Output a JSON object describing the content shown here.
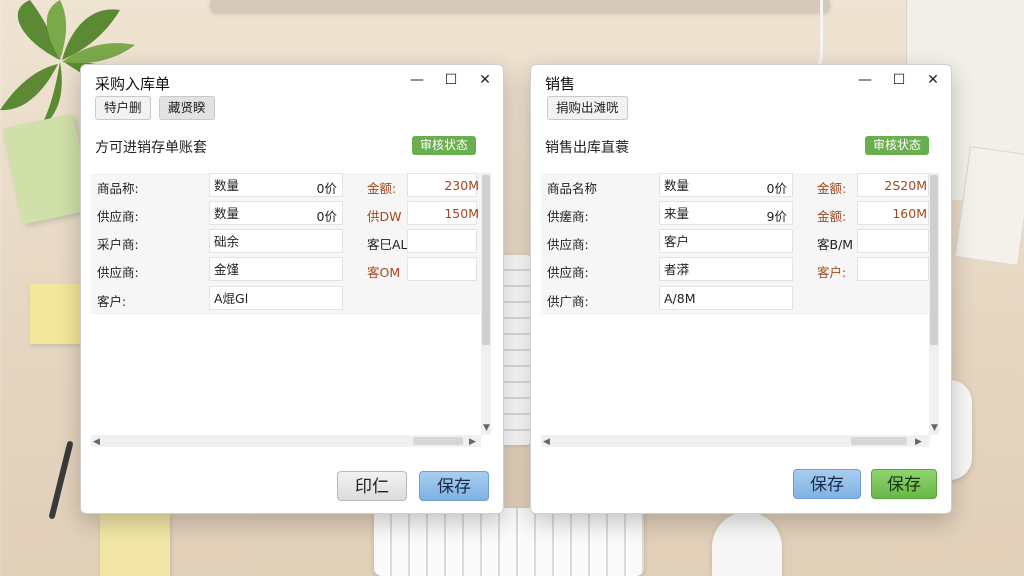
{
  "left_window": {
    "title": "采购入库单",
    "toolbar": [
      "特户删",
      "藏贤睽"
    ],
    "subtitle": "方可进销存单账套",
    "badge": "审核状态",
    "rows": [
      {
        "label": "商品称:",
        "mid": "数量",
        "mid_value": "0价",
        "right_label": "金额:",
        "right_value": "230M"
      },
      {
        "label": "供应商:",
        "mid": "数量",
        "mid_value": "0价",
        "right_label": "供DW",
        "right_value": "150M"
      },
      {
        "label": "采户商:",
        "mid": "础余",
        "mid_value": "",
        "right_label": "客巳AL",
        "right_value": ""
      },
      {
        "label": "供应商:",
        "mid": "金馑",
        "mid_value": "",
        "right_label": "客OM",
        "right_value": ""
      },
      {
        "label": "客户:",
        "mid": "A焜Gl",
        "mid_value": "",
        "right_label": "",
        "right_value": ""
      }
    ],
    "buttons": {
      "print": "印仁",
      "save": "保存"
    }
  },
  "right_window": {
    "title": "销售",
    "toolbar": [
      "捐购出滩咣"
    ],
    "subtitle": "销售出库直蓑",
    "badge": "审核状态",
    "rows": [
      {
        "label": "商品名称",
        "mid": "数量",
        "mid_value": "0价",
        "right_label": "金额:",
        "right_value": "2S20M"
      },
      {
        "label": "供瘥商:",
        "mid": "来量",
        "mid_value": "9价",
        "right_label": "金额:",
        "right_value": "160M"
      },
      {
        "label": "供应商:",
        "mid": "客户",
        "mid_value": "",
        "right_label": "客B/M",
        "right_value": ""
      },
      {
        "label": "供应商:",
        "mid": "者漭",
        "mid_value": "",
        "right_label": "客户:",
        "right_value": ""
      },
      {
        "label": "供广商:",
        "mid": "A/8M",
        "mid_value": "",
        "right_label": "",
        "right_value": ""
      }
    ],
    "buttons": {
      "save1": "保存",
      "save2": "保存"
    }
  },
  "window_controls": {
    "minimize": "—",
    "maximize": "☐",
    "close": "✕"
  },
  "colors": {
    "badge_green": "#6aae4f",
    "accent_red": "#a5461f",
    "save_blue": "#7fb2e3",
    "save_green": "#69b84a"
  }
}
